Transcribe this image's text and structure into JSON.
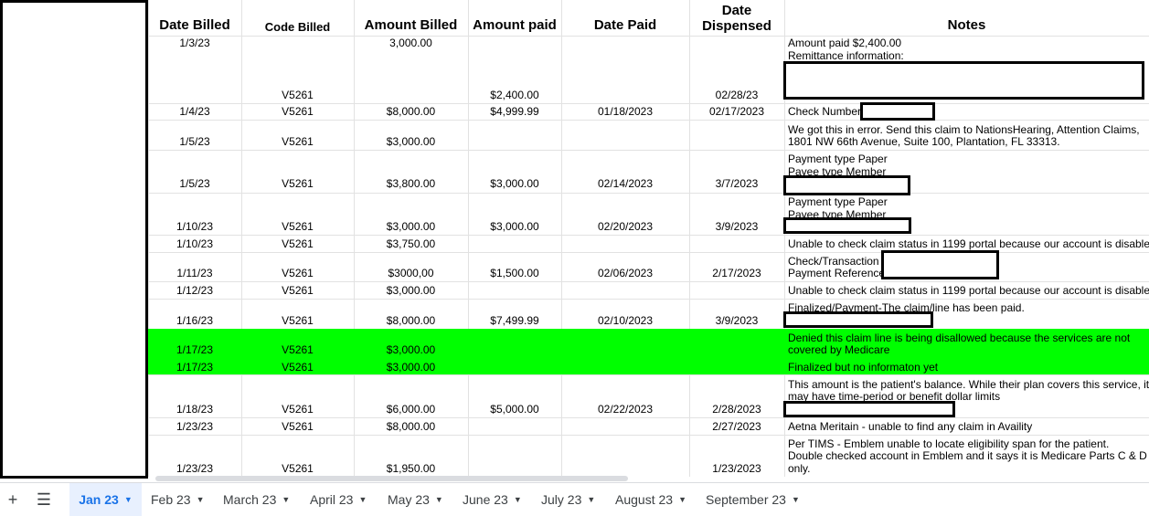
{
  "headers": {
    "date_billed": "Date Billed",
    "code_billed": "Code Billed",
    "amount_billed": "Amount Billed",
    "amount_paid": "Amount paid",
    "date_paid": "Date Paid",
    "date_dispensed_1": "Date",
    "date_dispensed_2": "Dispensed",
    "notes": "Notes"
  },
  "rows": [
    {
      "date_billed": "1/3/23",
      "code": "V5261",
      "amount_billed": "3,000.00",
      "amount_paid": "$2,400.00",
      "date_paid": "",
      "date_dispensed": "02/28/23",
      "notes": [
        "Amount paid $2,400.00",
        "Remittance information:"
      ]
    },
    {
      "date_billed": "1/4/23",
      "code": "V5261",
      "amount_billed": "$8,000.00",
      "amount_paid": "$4,999.99",
      "date_paid": "01/18/2023",
      "date_dispensed": "02/17/2023",
      "notes": [
        "Check Number"
      ]
    },
    {
      "date_billed": "1/5/23",
      "code": "V5261",
      "amount_billed": "$3,000.00",
      "amount_paid": "",
      "date_paid": "",
      "date_dispensed": "",
      "notes": [
        "We got this in error. Send this claim to NationsHearing, Attention Claims,",
        "1801 NW 66th Avenue, Suite 100, Plantation, FL 33313."
      ]
    },
    {
      "date_billed": "1/5/23",
      "code": "V5261",
      "amount_billed": "$3,800.00",
      "amount_paid": "$3,000.00",
      "date_paid": "02/14/2023",
      "date_dispensed": "3/7/2023",
      "notes": [
        "Payment type Paper",
        "Payee type Member"
      ]
    },
    {
      "date_billed": "1/10/23",
      "code": "V5261",
      "amount_billed": "$3,000.00",
      "amount_paid": "$3,000.00",
      "date_paid": "02/20/2023",
      "date_dispensed": "3/9/2023",
      "notes": [
        "Payment type Paper",
        "Payee type Member"
      ]
    },
    {
      "date_billed": "1/10/23",
      "code": "V5261",
      "amount_billed": "$3,750.00",
      "amount_paid": "",
      "date_paid": "",
      "date_dispensed": "",
      "notes": [
        "Unable to check claim status in 1199 portal because our account is disable"
      ]
    },
    {
      "date_billed": "1/11/23",
      "code": "V5261",
      "amount_billed": "$3000,00",
      "amount_paid": "$1,500.00",
      "date_paid": "02/06/2023",
      "date_dispensed": "2/17/2023",
      "notes": [
        "Check/Transaction",
        "Payment Reference"
      ]
    },
    {
      "date_billed": "1/12/23",
      "code": "V5261",
      "amount_billed": "$3,000.00",
      "amount_paid": "",
      "date_paid": "",
      "date_dispensed": "",
      "notes": [
        "Unable to check claim status in 1199 portal because our account is disable"
      ]
    },
    {
      "date_billed": "1/16/23",
      "code": "V5261",
      "amount_billed": "$8,000.00",
      "amount_paid": "$7,499.99",
      "date_paid": "02/10/2023",
      "date_dispensed": "3/9/2023",
      "notes": [
        "Finalized/Payment-The claim/line has been paid."
      ]
    },
    {
      "date_billed": "1/17/23",
      "code": "V5261",
      "amount_billed": "$3,000.00",
      "amount_paid": "",
      "date_paid": "",
      "date_dispensed": "",
      "notes": [
        "Denied this claim line is being disallowed because the services are not",
        "covered by Medicare"
      ]
    },
    {
      "date_billed": "1/17/23",
      "code": "V5261",
      "amount_billed": "$3,000.00",
      "amount_paid": "",
      "date_paid": "",
      "date_dispensed": "",
      "notes": [
        "Finalized but no informaton yet"
      ]
    },
    {
      "date_billed": "1/18/23",
      "code": "V5261",
      "amount_billed": "$6,000.00",
      "amount_paid": "$5,000.00",
      "date_paid": "02/22/2023",
      "date_dispensed": "2/28/2023",
      "notes": [
        "This amount is the patient's balance. While their plan covers this service, it",
        "may have time-period or benefit dollar limits"
      ]
    },
    {
      "date_billed": "1/23/23",
      "code": "V5261",
      "amount_billed": "$8,000.00",
      "amount_paid": "",
      "date_paid": "",
      "date_dispensed": "2/27/2023",
      "notes": [
        "Aetna Meritain - unable to find any claim in Availity"
      ]
    },
    {
      "date_billed": "1/23/23",
      "code": "V5261",
      "amount_billed": "$1,950.00",
      "amount_paid": "",
      "date_paid": "",
      "date_dispensed": "1/23/2023",
      "notes": [
        "Per TIMS - Emblem unable to locate eligibility span for the patient.",
        "Double checked account in Emblem and it says it is Medicare Parts C & D",
        "only."
      ]
    }
  ],
  "highlight_color": "#00ff00",
  "tabs": {
    "add_icon": "plus-icon",
    "menu_icon": "menu-icon",
    "items": [
      "Jan 23",
      "Feb 23",
      "March 23",
      "April 23",
      "May 23",
      "June 23",
      "July 23",
      "August 23",
      "September 23"
    ],
    "active": "Jan 23"
  }
}
